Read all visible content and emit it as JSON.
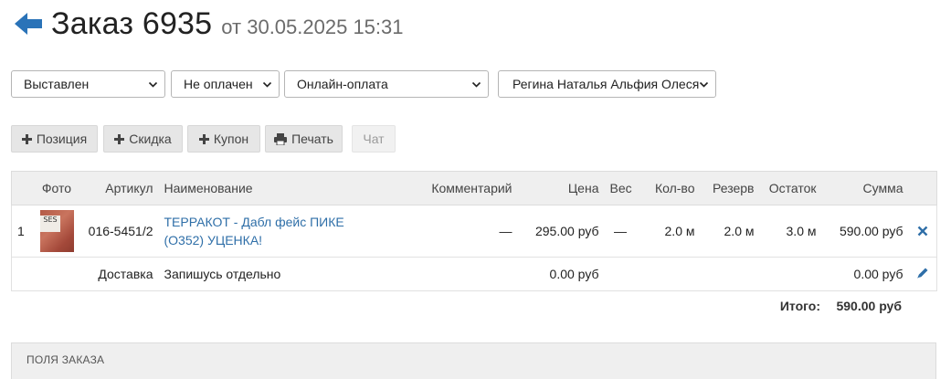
{
  "header": {
    "title": "Заказ 6935",
    "date": "от 30.05.2025 15:31"
  },
  "filters": {
    "status": "Выставлен",
    "payment_status": "Не оплачен",
    "payment_method": "Онлайн-оплата",
    "manager": "Регина Наталья Альфия Олеся"
  },
  "actions": {
    "position": "Позиция",
    "discount": "Скидка",
    "coupon": "Купон",
    "print": "Печать",
    "chat": "Чат"
  },
  "table": {
    "columns": {
      "photo": "Фото",
      "sku": "Артикул",
      "name": "Наименование",
      "comment": "Комментарий",
      "price": "Цена",
      "weight": "Вес",
      "qty": "Кол-во",
      "reserve": "Резерв",
      "stock": "Остаток",
      "sum": "Сумма"
    },
    "items": [
      {
        "index": "1",
        "thumb_text": "SES",
        "sku": "016-5451/2",
        "name": "ТЕРРАКОТ - Дабл фейс ПИКЕ (О352) УЦЕНКА!",
        "comment": "—",
        "price": "295.00 руб",
        "weight": "—",
        "qty": "2.0 м",
        "reserve": "2.0 м",
        "stock": "3.0 м",
        "sum": "590.00 руб"
      }
    ],
    "delivery": {
      "label": "Доставка",
      "name": "Запишусь отдельно",
      "price": "0.00 руб",
      "sum": "0.00 руб"
    }
  },
  "totals": {
    "label": "Итого:",
    "value": "590.00 руб"
  },
  "order_fields": {
    "title": "Поля заказа"
  },
  "colors": {
    "accent": "#2f6fa8",
    "button_bg": "#e6e6e6",
    "header_bg": "#efefef"
  },
  "icons": {
    "back": "arrow-left-icon",
    "plus": "plus-icon",
    "print": "printer-icon",
    "delete": "close-icon",
    "edit": "pencil-icon",
    "dropdown": "chevron-down-icon"
  }
}
